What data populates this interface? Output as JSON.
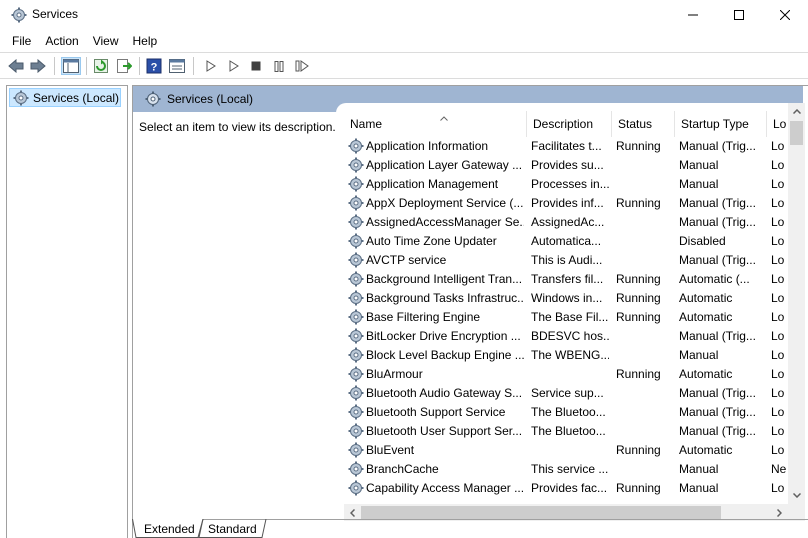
{
  "window": {
    "title": "Services"
  },
  "menu": [
    "File",
    "Action",
    "View",
    "Help"
  ],
  "tree": {
    "item": "Services (Local)"
  },
  "pane": {
    "header": "Services (Local)",
    "description": "Select an item to view its description."
  },
  "columns": {
    "name": "Name",
    "description": "Description",
    "status": "Status",
    "startup": "Startup Type",
    "logon": "Lo"
  },
  "services": [
    {
      "name": "Application Information",
      "description": "Facilitates t...",
      "status": "Running",
      "startup": "Manual (Trig...",
      "logon": "Lo"
    },
    {
      "name": "Application Layer Gateway ...",
      "description": "Provides su...",
      "status": "",
      "startup": "Manual",
      "logon": "Lo"
    },
    {
      "name": "Application Management",
      "description": "Processes in...",
      "status": "",
      "startup": "Manual",
      "logon": "Lo"
    },
    {
      "name": "AppX Deployment Service (...",
      "description": "Provides inf...",
      "status": "Running",
      "startup": "Manual (Trig...",
      "logon": "Lo"
    },
    {
      "name": "AssignedAccessManager Se...",
      "description": "AssignedAc...",
      "status": "",
      "startup": "Manual (Trig...",
      "logon": "Lo"
    },
    {
      "name": "Auto Time Zone Updater",
      "description": "Automatica...",
      "status": "",
      "startup": "Disabled",
      "logon": "Lo"
    },
    {
      "name": "AVCTP service",
      "description": "This is Audi...",
      "status": "",
      "startup": "Manual (Trig...",
      "logon": "Lo"
    },
    {
      "name": "Background Intelligent Tran...",
      "description": "Transfers fil...",
      "status": "Running",
      "startup": "Automatic (...",
      "logon": "Lo"
    },
    {
      "name": "Background Tasks Infrastruc...",
      "description": "Windows in...",
      "status": "Running",
      "startup": "Automatic",
      "logon": "Lo"
    },
    {
      "name": "Base Filtering Engine",
      "description": "The Base Fil...",
      "status": "Running",
      "startup": "Automatic",
      "logon": "Lo"
    },
    {
      "name": "BitLocker Drive Encryption ...",
      "description": "BDESVC hos...",
      "status": "",
      "startup": "Manual (Trig...",
      "logon": "Lo"
    },
    {
      "name": "Block Level Backup Engine ...",
      "description": "The WBENG...",
      "status": "",
      "startup": "Manual",
      "logon": "Lo"
    },
    {
      "name": "BluArmour",
      "description": "",
      "status": "Running",
      "startup": "Automatic",
      "logon": "Lo"
    },
    {
      "name": "Bluetooth Audio Gateway S...",
      "description": "Service sup...",
      "status": "",
      "startup": "Manual (Trig...",
      "logon": "Lo"
    },
    {
      "name": "Bluetooth Support Service",
      "description": "The Bluetoo...",
      "status": "",
      "startup": "Manual (Trig...",
      "logon": "Lo"
    },
    {
      "name": "Bluetooth User Support Ser...",
      "description": "The Bluetoo...",
      "status": "",
      "startup": "Manual (Trig...",
      "logon": "Lo"
    },
    {
      "name": "BluEvent",
      "description": "",
      "status": "Running",
      "startup": "Automatic",
      "logon": "Lo"
    },
    {
      "name": "BranchCache",
      "description": "This service ...",
      "status": "",
      "startup": "Manual",
      "logon": "Ne"
    },
    {
      "name": "Capability Access Manager ...",
      "description": "Provides fac...",
      "status": "Running",
      "startup": "Manual",
      "logon": "Lo"
    }
  ],
  "tabs": {
    "extended": "Extended",
    "standard": "Standard"
  },
  "colors": {
    "pane_header": "#9fb5d2",
    "selection": "#cce8ff"
  }
}
